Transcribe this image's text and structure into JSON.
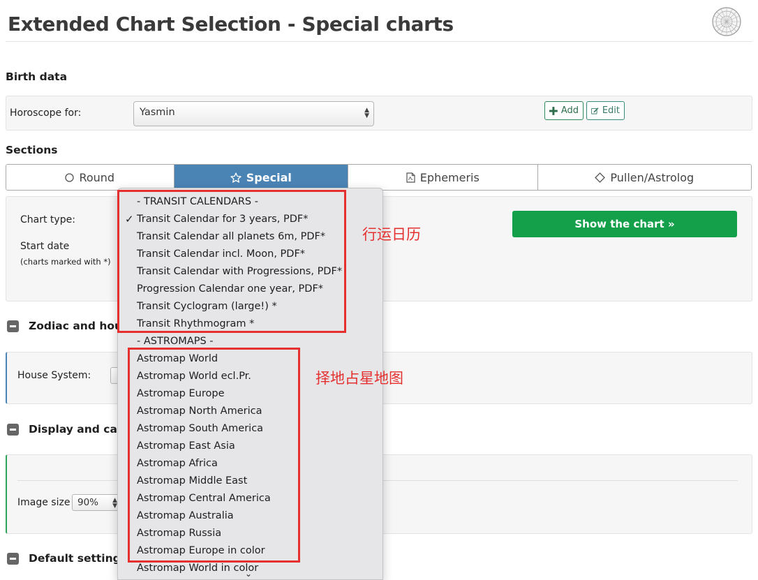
{
  "header": {
    "title": "Extended Chart Selection - Special charts",
    "logo_icon": "astro-wheel-icon"
  },
  "birth": {
    "heading": "Birth data",
    "label": "Horoscope for:",
    "selected": "Yasmin",
    "add_label": "Add",
    "edit_label": "Edit"
  },
  "sections": {
    "heading": "Sections",
    "tabs": [
      {
        "label": "Round",
        "icon": "circle-icon"
      },
      {
        "label": "Special",
        "icon": "star-icon"
      },
      {
        "label": "Ephemeris",
        "icon": "pdf-file-icon"
      },
      {
        "label": "Pullen/Astrolog",
        "icon": "diamond-icon"
      }
    ]
  },
  "special": {
    "chart_type_label": "Chart type:",
    "start_date_label": "Start date",
    "charts_marked_note": "(charts marked with *)",
    "show_button": "Show the chart »"
  },
  "zodiac": {
    "heading": "Zodiac and hous",
    "house_system_label": "House System:"
  },
  "display": {
    "heading": "Display and calc",
    "image_size_label": "Image size",
    "image_size_value": "90%"
  },
  "defaults": {
    "heading": "Default settings"
  },
  "dropdown": {
    "items": [
      "- TRANSIT CALENDARS -",
      "Transit Calendar for 3 years, PDF*",
      "Transit Calendar all planets 6m, PDF*",
      "Transit Calendar incl. Moon, PDF*",
      "Transit Calendar with Progressions, PDF*",
      "Progression Calendar one year, PDF*",
      "Transit Cyclogram (large!) *",
      "Transit Rhythmogram *",
      "- ASTROMAPS -",
      "Astromap World",
      "Astromap World ecl.Pr.",
      "Astromap Europe",
      "Astromap North America",
      "Astromap South America",
      "Astromap East Asia",
      "Astromap Africa",
      "Astromap Middle East",
      "Astromap Central America",
      "Astromap Australia",
      "Astromap Russia",
      "Astromap Europe in color",
      "Astromap World in color"
    ],
    "checkmark": "✓",
    "scroll_indicator": "⌄"
  },
  "annotations": {
    "transit_calendars": "行运日历",
    "astromaps": "择地占星地图"
  }
}
